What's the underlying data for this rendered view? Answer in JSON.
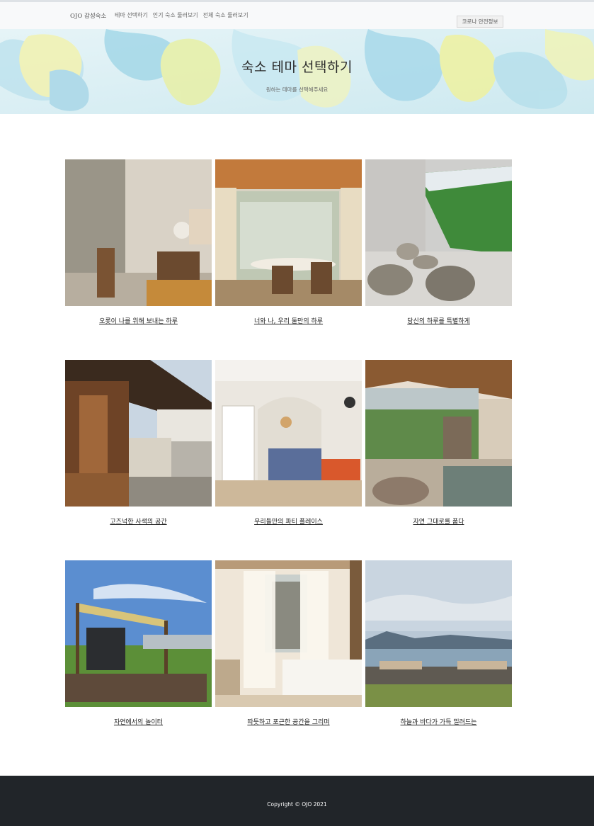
{
  "nav": {
    "brand": "OJO 감성숙소",
    "links": [
      "테마 선택하기",
      "인기 숙소 둘러보기",
      "전체 숙소 둘러보기"
    ],
    "covid_button": "코로나 안전정보"
  },
  "hero": {
    "title": "숙소 테마 선택하기",
    "subtitle": "원하는 테마를 선택해주세요"
  },
  "themes": [
    {
      "caption": "오롯이 나를 위해 보내는 하루",
      "icon": "study-room-image"
    },
    {
      "caption": "너와 나, 우리 둘만의 하루",
      "icon": "dining-room-image"
    },
    {
      "caption": "당신의 하루를 특별하게",
      "icon": "terrace-image"
    },
    {
      "caption": "고즈넉한 사색의 공간",
      "icon": "hanok-image"
    },
    {
      "caption": "우리들만의 파티 플레이스",
      "icon": "party-room-image"
    },
    {
      "caption": "자연 그대로를 품다",
      "icon": "garden-view-image"
    },
    {
      "caption": "자연에서의 놀이터",
      "icon": "outdoor-deck-image"
    },
    {
      "caption": "따듯하고 포근한 공간을 그리며",
      "icon": "cozy-bedroom-image"
    },
    {
      "caption": "하늘과 바다가 가득 밀려드는",
      "icon": "ocean-view-image"
    }
  ],
  "footer": {
    "copyright": "Copyright © OJO 2021"
  }
}
